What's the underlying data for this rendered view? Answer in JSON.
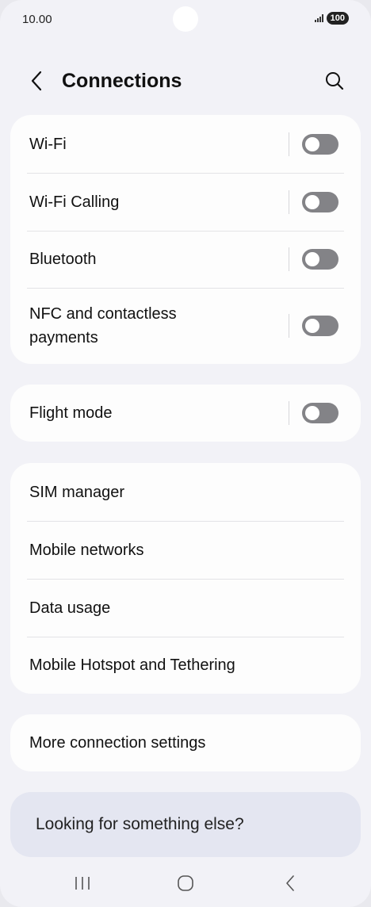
{
  "status_bar": {
    "time": "10.00",
    "battery": "100"
  },
  "header": {
    "title": "Connections",
    "back_icon": "chevron-left-icon",
    "search_icon": "search-icon"
  },
  "groups": {
    "radios": [
      {
        "label": "Wi-Fi",
        "toggle": "off"
      },
      {
        "label": "Wi-Fi Calling",
        "toggle": "off"
      },
      {
        "label": "Bluetooth",
        "toggle": "off"
      },
      {
        "label": "NFC and contactless payments",
        "toggle": "off"
      }
    ],
    "flight": [
      {
        "label": "Flight mode",
        "toggle": "off"
      }
    ],
    "network": [
      {
        "label": "SIM manager"
      },
      {
        "label": "Mobile networks"
      },
      {
        "label": "Data usage"
      },
      {
        "label": "Mobile Hotspot and Tethering"
      }
    ],
    "more": [
      {
        "label": "More connection settings"
      }
    ]
  },
  "suggestion": {
    "text": "Looking for something else?"
  },
  "nav_bar": {
    "recents_icon": "recents-icon",
    "home_icon": "home-icon",
    "back_icon": "back-icon"
  },
  "colors": {
    "background": "#f2f2f7",
    "card": "#fdfdfd",
    "toggle_off": "#838387",
    "suggestion_bg": "#e4e6f1"
  }
}
